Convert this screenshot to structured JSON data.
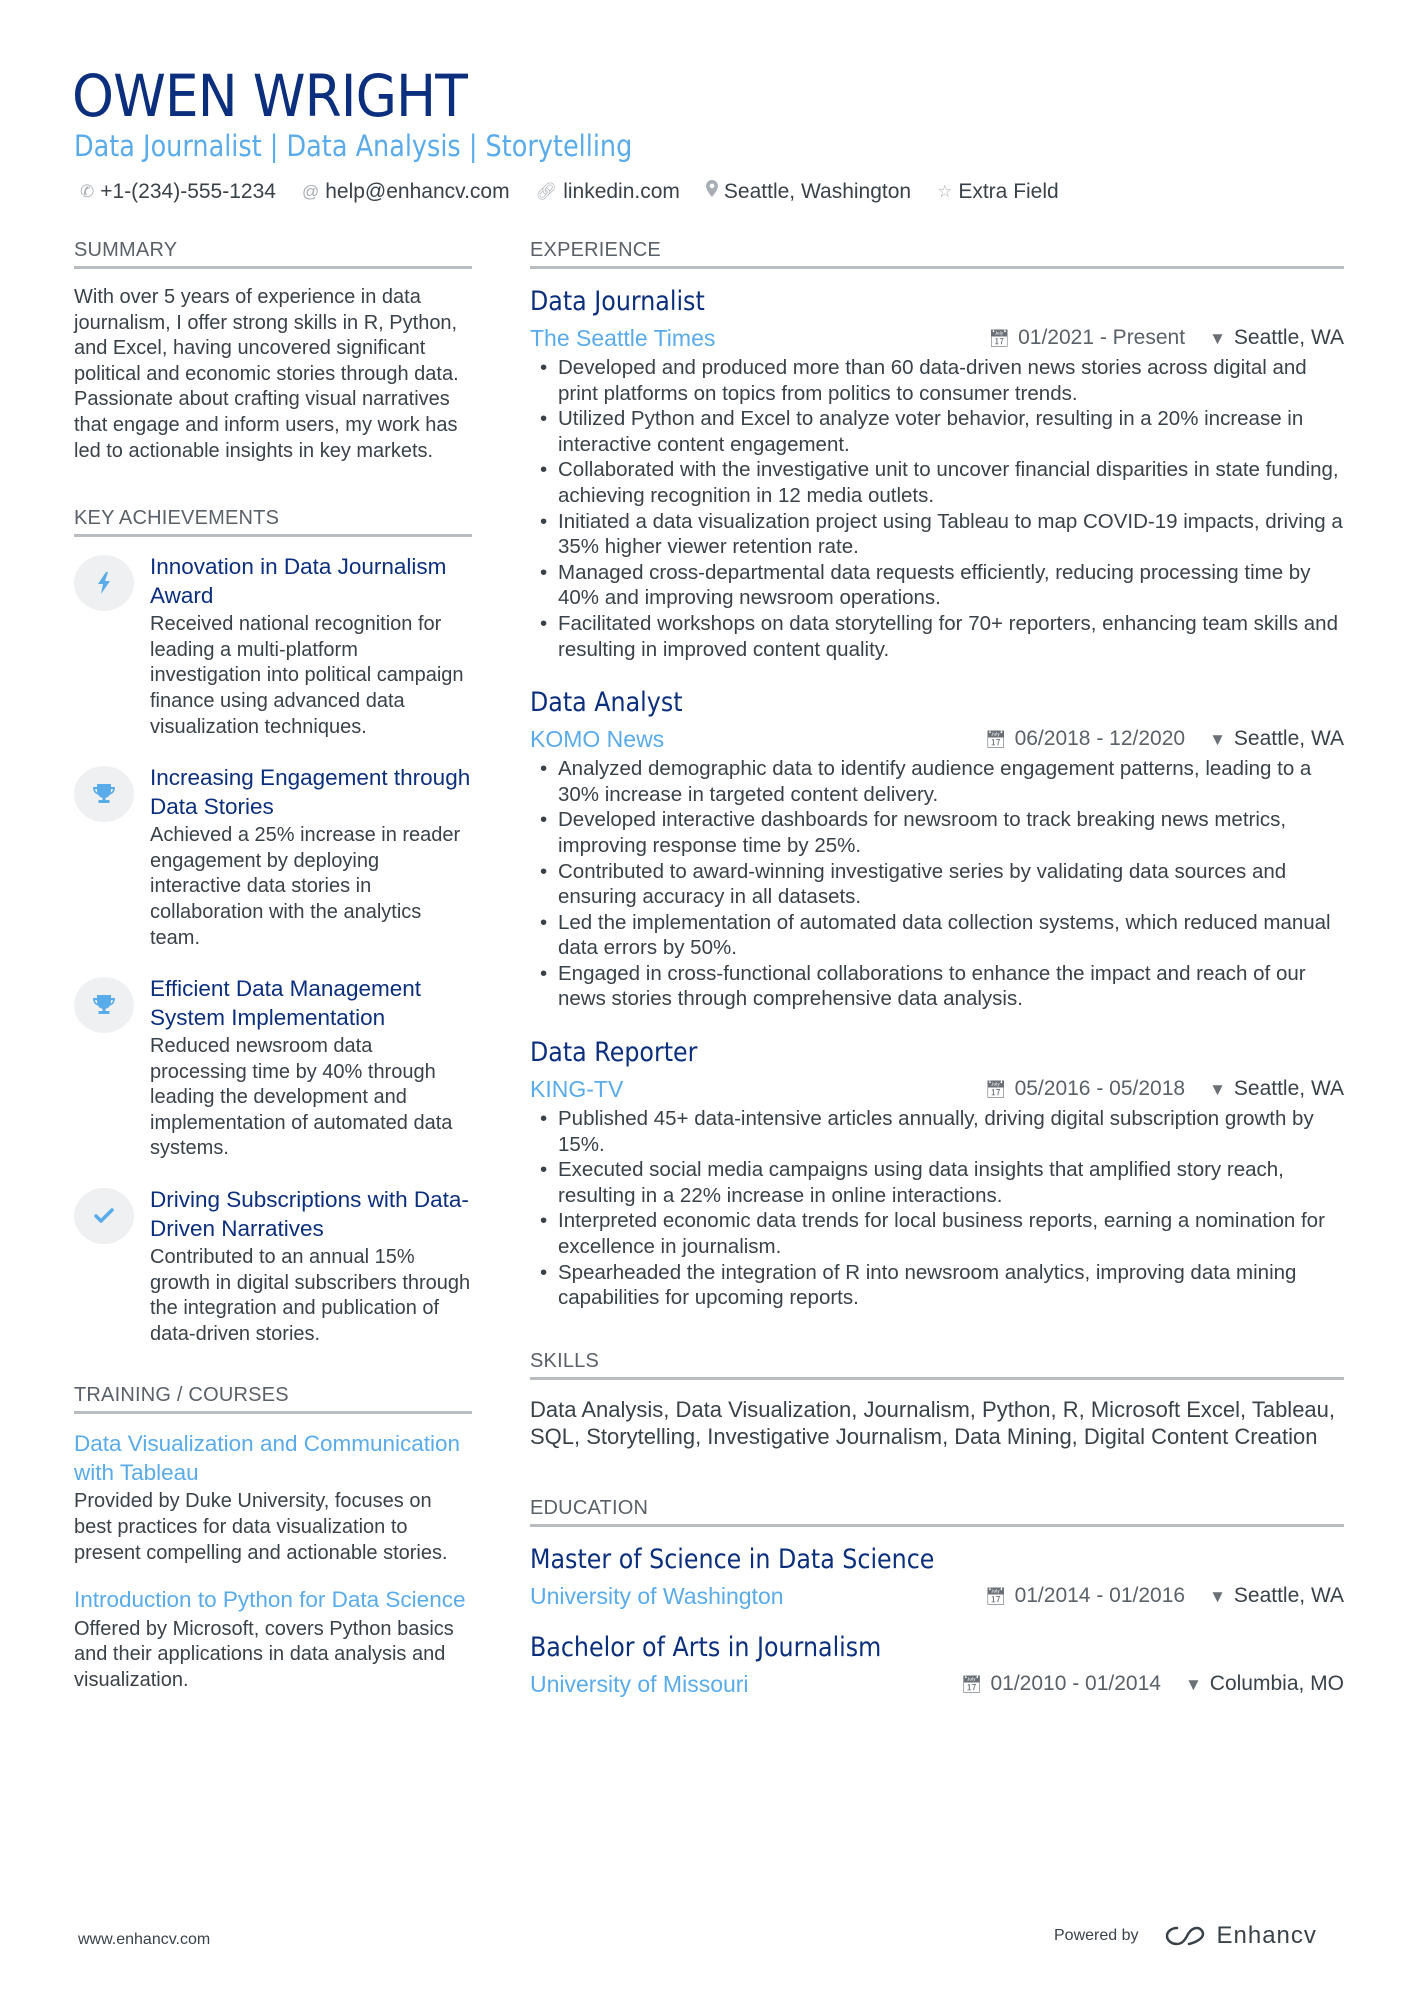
{
  "header": {
    "name": "OWEN WRIGHT",
    "title": "Data Journalist | Data Analysis | Storytelling",
    "contacts": [
      {
        "icon": "phone-icon",
        "text": "+1-(234)-555-1234"
      },
      {
        "icon": "at-icon",
        "text": "help@enhancv.com"
      },
      {
        "icon": "link-icon",
        "text": "linkedin.com"
      },
      {
        "icon": "location-pin-icon",
        "text": "Seattle, Washington"
      },
      {
        "icon": "star-icon",
        "text": "Extra Field"
      }
    ]
  },
  "summary": {
    "heading": "SUMMARY",
    "text": "With over 5 years of experience in data journalism, I offer strong skills in R, Python, and Excel, having uncovered significant political and economic stories through data. Passionate about crafting visual narratives that engage and inform users, my work has led to actionable insights in key markets."
  },
  "achievements": {
    "heading": "KEY ACHIEVEMENTS",
    "items": [
      {
        "icon": "lightning-bolt-icon",
        "title": "Innovation in Data Journalism Award",
        "description": "Received national recognition for leading a multi-platform investigation into political campaign finance using advanced data visualization techniques."
      },
      {
        "icon": "trophy-icon",
        "title": "Increasing Engagement through Data Stories",
        "description": "Achieved a 25% increase in reader engagement by deploying interactive data stories in collaboration with the analytics team."
      },
      {
        "icon": "trophy-icon",
        "title": "Efficient Data Management System Implementation",
        "description": "Reduced newsroom data processing time by 40% through leading the development and implementation of automated data systems."
      },
      {
        "icon": "checkmark-icon",
        "title": "Driving Subscriptions with Data-Driven Narratives",
        "description": "Contributed to an annual 15% growth in digital subscribers through the integration and publication of data-driven stories."
      }
    ]
  },
  "training": {
    "heading": "TRAINING / COURSES",
    "items": [
      {
        "title": "Data Visualization and Communication with Tableau",
        "description": "Provided by Duke University, focuses on best practices for data visualization to present compelling and actionable stories."
      },
      {
        "title": "Introduction to Python for Data Science",
        "description": "Offered by Microsoft, covers Python basics and their applications in data analysis and visualization."
      }
    ]
  },
  "experience": {
    "heading": "EXPERIENCE",
    "jobs": [
      {
        "title": "Data Journalist",
        "company": "The Seattle Times",
        "dates": "01/2021 - Present",
        "location": "Seattle, WA",
        "bullets": [
          "Developed and produced more than 60 data-driven news stories across digital and print platforms on topics from politics to consumer trends.",
          "Utilized Python and Excel to analyze voter behavior, resulting in a 20% increase in interactive content engagement.",
          "Collaborated with the investigative unit to uncover financial disparities in state funding, achieving recognition in 12 media outlets.",
          "Initiated a data visualization project using Tableau to map COVID-19 impacts, driving a 35% higher viewer retention rate.",
          "Managed cross-departmental data requests efficiently, reducing processing time by 40% and improving newsroom operations.",
          "Facilitated workshops on data storytelling for 70+ reporters, enhancing team skills and resulting in improved content quality."
        ]
      },
      {
        "title": "Data Analyst",
        "company": "KOMO News",
        "dates": "06/2018 - 12/2020",
        "location": "Seattle, WA",
        "bullets": [
          "Analyzed demographic data to identify audience engagement patterns, leading to a 30% increase in targeted content delivery.",
          "Developed interactive dashboards for newsroom to track breaking news metrics, improving response time by 25%.",
          "Contributed to award-winning investigative series by validating data sources and ensuring accuracy in all datasets.",
          "Led the implementation of automated data collection systems, which reduced manual data errors by 50%.",
          "Engaged in cross-functional collaborations to enhance the impact and reach of our news stories through comprehensive data analysis."
        ]
      },
      {
        "title": "Data Reporter",
        "company": "KING-TV",
        "dates": "05/2016 - 05/2018",
        "location": "Seattle, WA",
        "bullets": [
          "Published 45+ data-intensive articles annually, driving digital subscription growth by 15%.",
          "Executed social media campaigns using data insights that amplified story reach, resulting in a 22% increase in online interactions.",
          "Interpreted economic data trends for local business reports, earning a nomination for excellence in journalism.",
          "Spearheaded the integration of R into newsroom analytics, improving data mining capabilities for upcoming reports."
        ]
      }
    ]
  },
  "skills": {
    "heading": "SKILLS",
    "text": "Data Analysis, Data Visualization, Journalism, Python, R, Microsoft Excel, Tableau, SQL, Storytelling, Investigative Journalism, Data Mining, Digital Content Creation"
  },
  "education": {
    "heading": "EDUCATION",
    "items": [
      {
        "degree": "Master of Science in Data Science",
        "school": "University of Washington",
        "dates": "01/2014 - 01/2016",
        "location": "Seattle, WA"
      },
      {
        "degree": "Bachelor of Arts in Journalism",
        "school": "University of Missouri",
        "dates": "01/2010 - 01/2014",
        "location": "Columbia, MO"
      }
    ]
  },
  "footer": {
    "website": "www.enhancv.com",
    "powered_by": "Powered by",
    "brand": "Enhancv"
  },
  "colors": {
    "name": "#0c2f7d",
    "accent": "#5aabea",
    "text": "#3a4249",
    "rule": "#b9bdc1"
  }
}
